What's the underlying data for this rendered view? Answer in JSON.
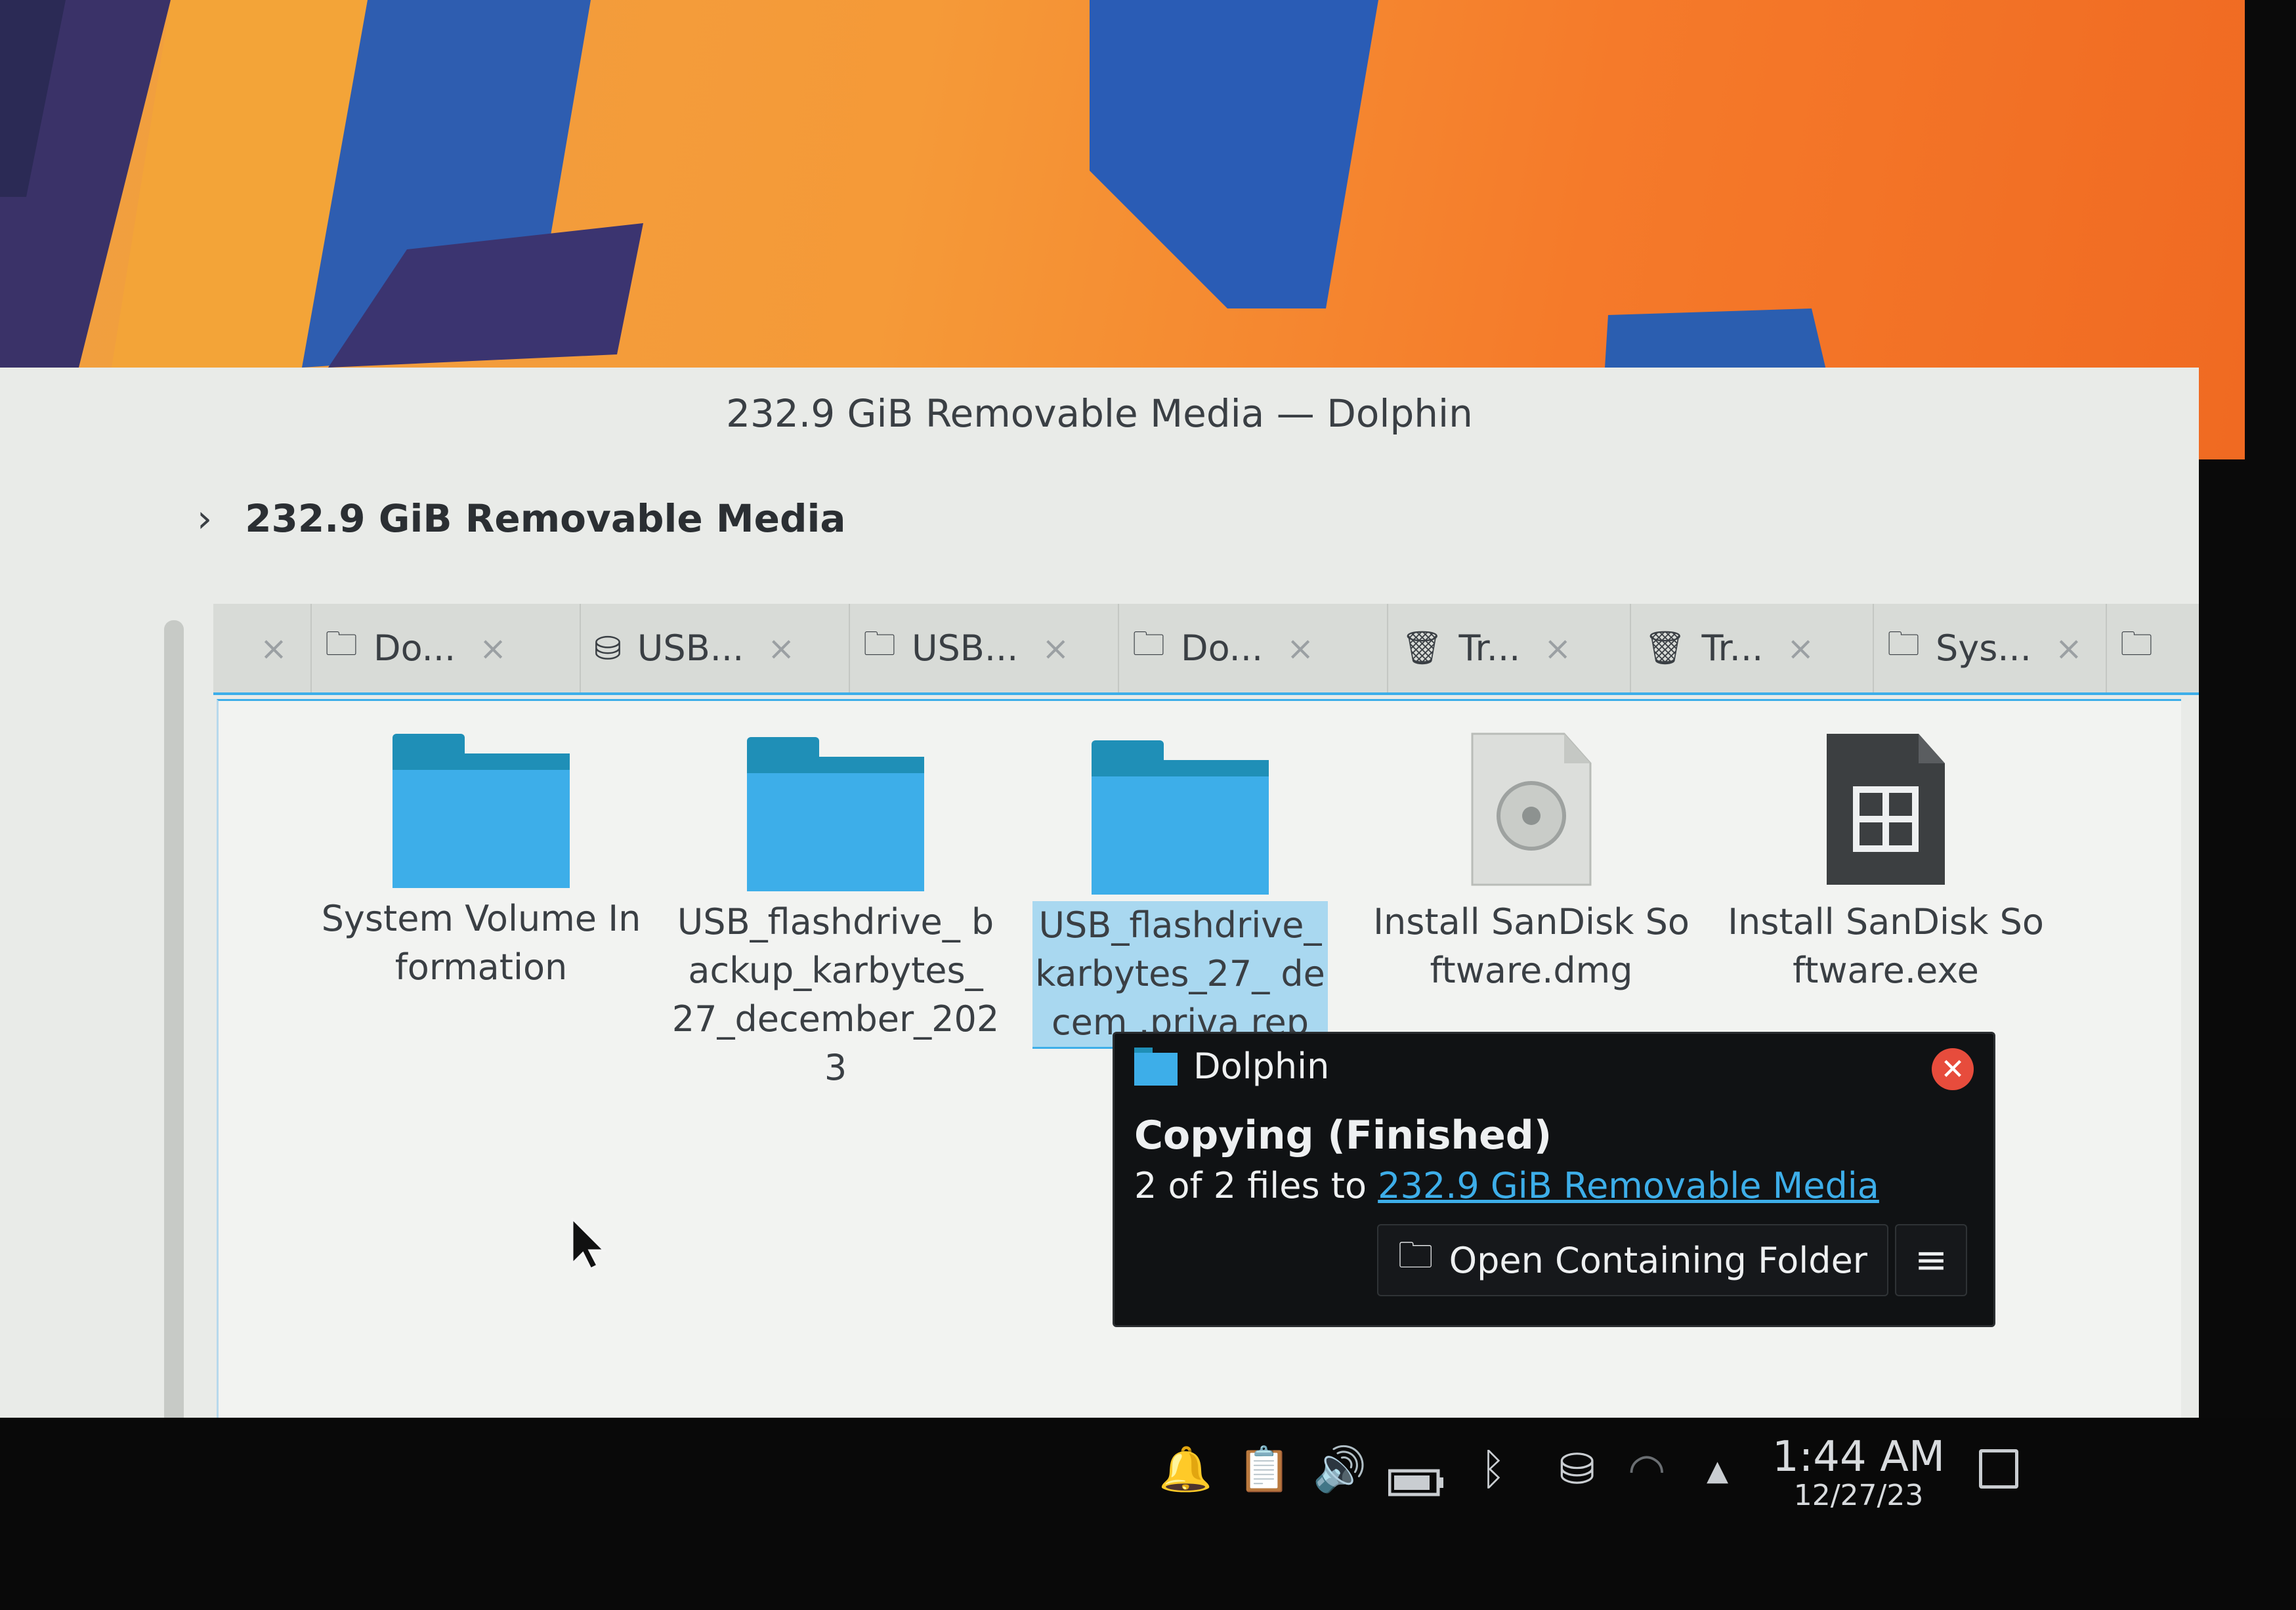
{
  "window": {
    "title": "232.9 GiB Removable Media — Dolphin"
  },
  "breadcrumb": {
    "chevron": "›",
    "current": "232.9 GiB Removable Media"
  },
  "tabs": [
    {
      "label": "Do...",
      "icon": "folder-icon"
    },
    {
      "label": "USB...",
      "icon": "drive-icon"
    },
    {
      "label": "USB...",
      "icon": "folder-icon"
    },
    {
      "label": "Do...",
      "icon": "folder-icon"
    },
    {
      "label": "Tr...",
      "icon": "trash-icon"
    },
    {
      "label": "Tr...",
      "icon": "trash-icon"
    },
    {
      "label": "Sys...",
      "icon": "folder-icon"
    }
  ],
  "tab_close_glyph": "×",
  "files": [
    {
      "name": "System Volume Information",
      "type": "folder"
    },
    {
      "name": "USB_flashdrive_ backup_karbytes_ 27_december_2023",
      "type": "folder"
    },
    {
      "name": "USB_flashdrive_ karbytes_27_ decem .priva rep",
      "type": "folder",
      "selected": true
    },
    {
      "name": "Install SanDisk Software.dmg",
      "type": "disk-image"
    },
    {
      "name": "Install SanDisk Software.exe",
      "type": "executable"
    }
  ],
  "notification": {
    "app": "Dolphin",
    "title": "Copying (Finished)",
    "body_prefix": "2 of 2 files to ",
    "link": "232.9 GiB Removable Media",
    "action": "Open Containing Folder",
    "menu_glyph": "≡",
    "close_glyph": "✕"
  },
  "taskbar": {
    "time": "1:44 AM",
    "date": "12/27/23",
    "tray_icons": [
      "notifications-icon",
      "clipboard-icon",
      "volume-icon",
      "battery-icon",
      "bluetooth-icon",
      "usb-drive-icon",
      "wifi-icon",
      "expand-tray-icon"
    ]
  },
  "colors": {
    "accent": "#3daee9",
    "folder": "#3daee9",
    "folder_dark": "#1f8fb7",
    "notification_bg": "#101214",
    "close": "#e74c3c"
  }
}
